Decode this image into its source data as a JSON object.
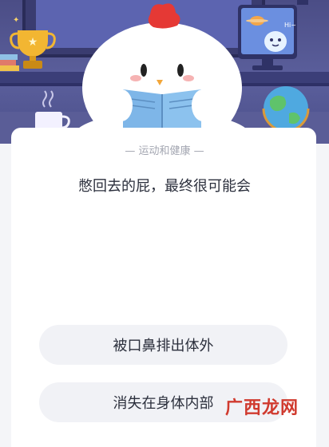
{
  "category_label": "运动和健康",
  "question": "憋回去的屁，最终很可能会",
  "options": [
    {
      "label": "被口鼻排出体外"
    },
    {
      "label": "消失在身体内部"
    }
  ],
  "watermark": "广西龙网",
  "scene_text": {
    "monitor_greeting": "Hi~"
  },
  "colors": {
    "scene_bg": "#4b4d86",
    "card_bg": "#ffffff",
    "option_bg": "#f1f2f6",
    "text_primary": "#2b2f3c",
    "text_secondary": "#a3a6b1",
    "comb_red": "#e53935",
    "book_blue": "#7eb6e8"
  },
  "icons": [
    "trophy-icon",
    "monitor-alien-icon",
    "globe-icon",
    "cup-icon",
    "chicken-mascot"
  ]
}
